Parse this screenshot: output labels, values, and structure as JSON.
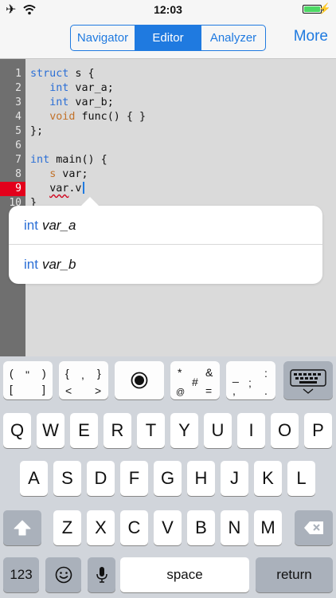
{
  "status": {
    "time": "12:03"
  },
  "nav": {
    "tabs": [
      {
        "label": "Navigator",
        "active": false
      },
      {
        "label": "Editor",
        "active": true
      },
      {
        "label": "Analyzer",
        "active": false
      }
    ],
    "more_label": "More"
  },
  "editor": {
    "line_numbers": [
      "1",
      "2",
      "3",
      "4",
      "5",
      "6",
      "7",
      "8",
      "9",
      "10"
    ],
    "error_line": "9",
    "code": {
      "l1_kw": "struct",
      "l1_rest": " s {",
      "l2_kw": "int",
      "l2_rest": " var_a;",
      "l3_kw": "int",
      "l3_rest": " var_b;",
      "l4_kw": "void",
      "l4_rest": " func() { }",
      "l5": "};",
      "l7_kw": "int",
      "l7_rest": " main() {",
      "l8_type": "s",
      "l8_rest": " var;",
      "l9_err": "var",
      "l9_rest": ".v",
      "l10": "}"
    }
  },
  "completion": {
    "items": [
      {
        "type": "int",
        "name": "var_a"
      },
      {
        "type": "int",
        "name": "var_b"
      }
    ]
  },
  "keyboard": {
    "accessory": {
      "k1": {
        "a": "(",
        "b": "\"",
        "c": ")",
        "d": "[",
        "e": "]"
      },
      "k2": {
        "a": "{",
        "b": ",",
        "c": "}",
        "d": "<",
        "e": ">"
      },
      "k3": {
        "a": "*",
        "b": "&",
        "c": "#",
        "d": "@",
        "e": "="
      },
      "k4": {
        "a": "_",
        "b": ":",
        "c": ";",
        "d": ",",
        "e": "."
      }
    },
    "row1": [
      "Q",
      "W",
      "E",
      "R",
      "T",
      "Y",
      "U",
      "I",
      "O",
      "P"
    ],
    "row2": [
      "A",
      "S",
      "D",
      "F",
      "G",
      "H",
      "J",
      "K",
      "L"
    ],
    "row3": [
      "Z",
      "X",
      "C",
      "V",
      "B",
      "N",
      "M"
    ],
    "numbers_label": "123",
    "space_label": "space",
    "return_label": "return",
    "icons": [
      "airplane-icon",
      "wifi-icon",
      "battery-icon",
      "charging-icon",
      "record-icon",
      "keyboard-hide-icon",
      "shift-icon",
      "delete-icon",
      "emoji-icon",
      "microphone-icon"
    ]
  }
}
